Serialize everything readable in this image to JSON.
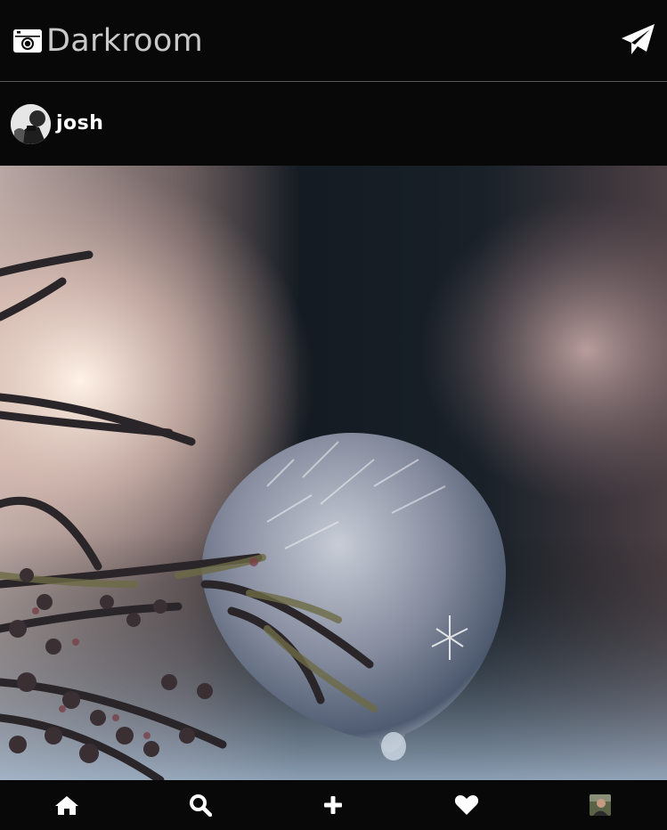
{
  "app": {
    "title": "Darkroom",
    "brand_icon": "camera-icon",
    "dm_icon": "paper-plane-icon"
  },
  "post": {
    "username": "josh",
    "avatar_icon": "user-avatar",
    "image_subject": "frozen-soap-bubble-on-branch"
  },
  "bottom_nav": {
    "items": [
      {
        "icon": "home-icon"
      },
      {
        "icon": "search-icon"
      },
      {
        "icon": "plus-icon"
      },
      {
        "icon": "heart-icon"
      },
      {
        "icon": "profile-avatar"
      }
    ]
  },
  "colors": {
    "background": "#080808",
    "divider": "#5a5a5a",
    "title": "#c9c9c9",
    "icon": "#ffffff"
  }
}
